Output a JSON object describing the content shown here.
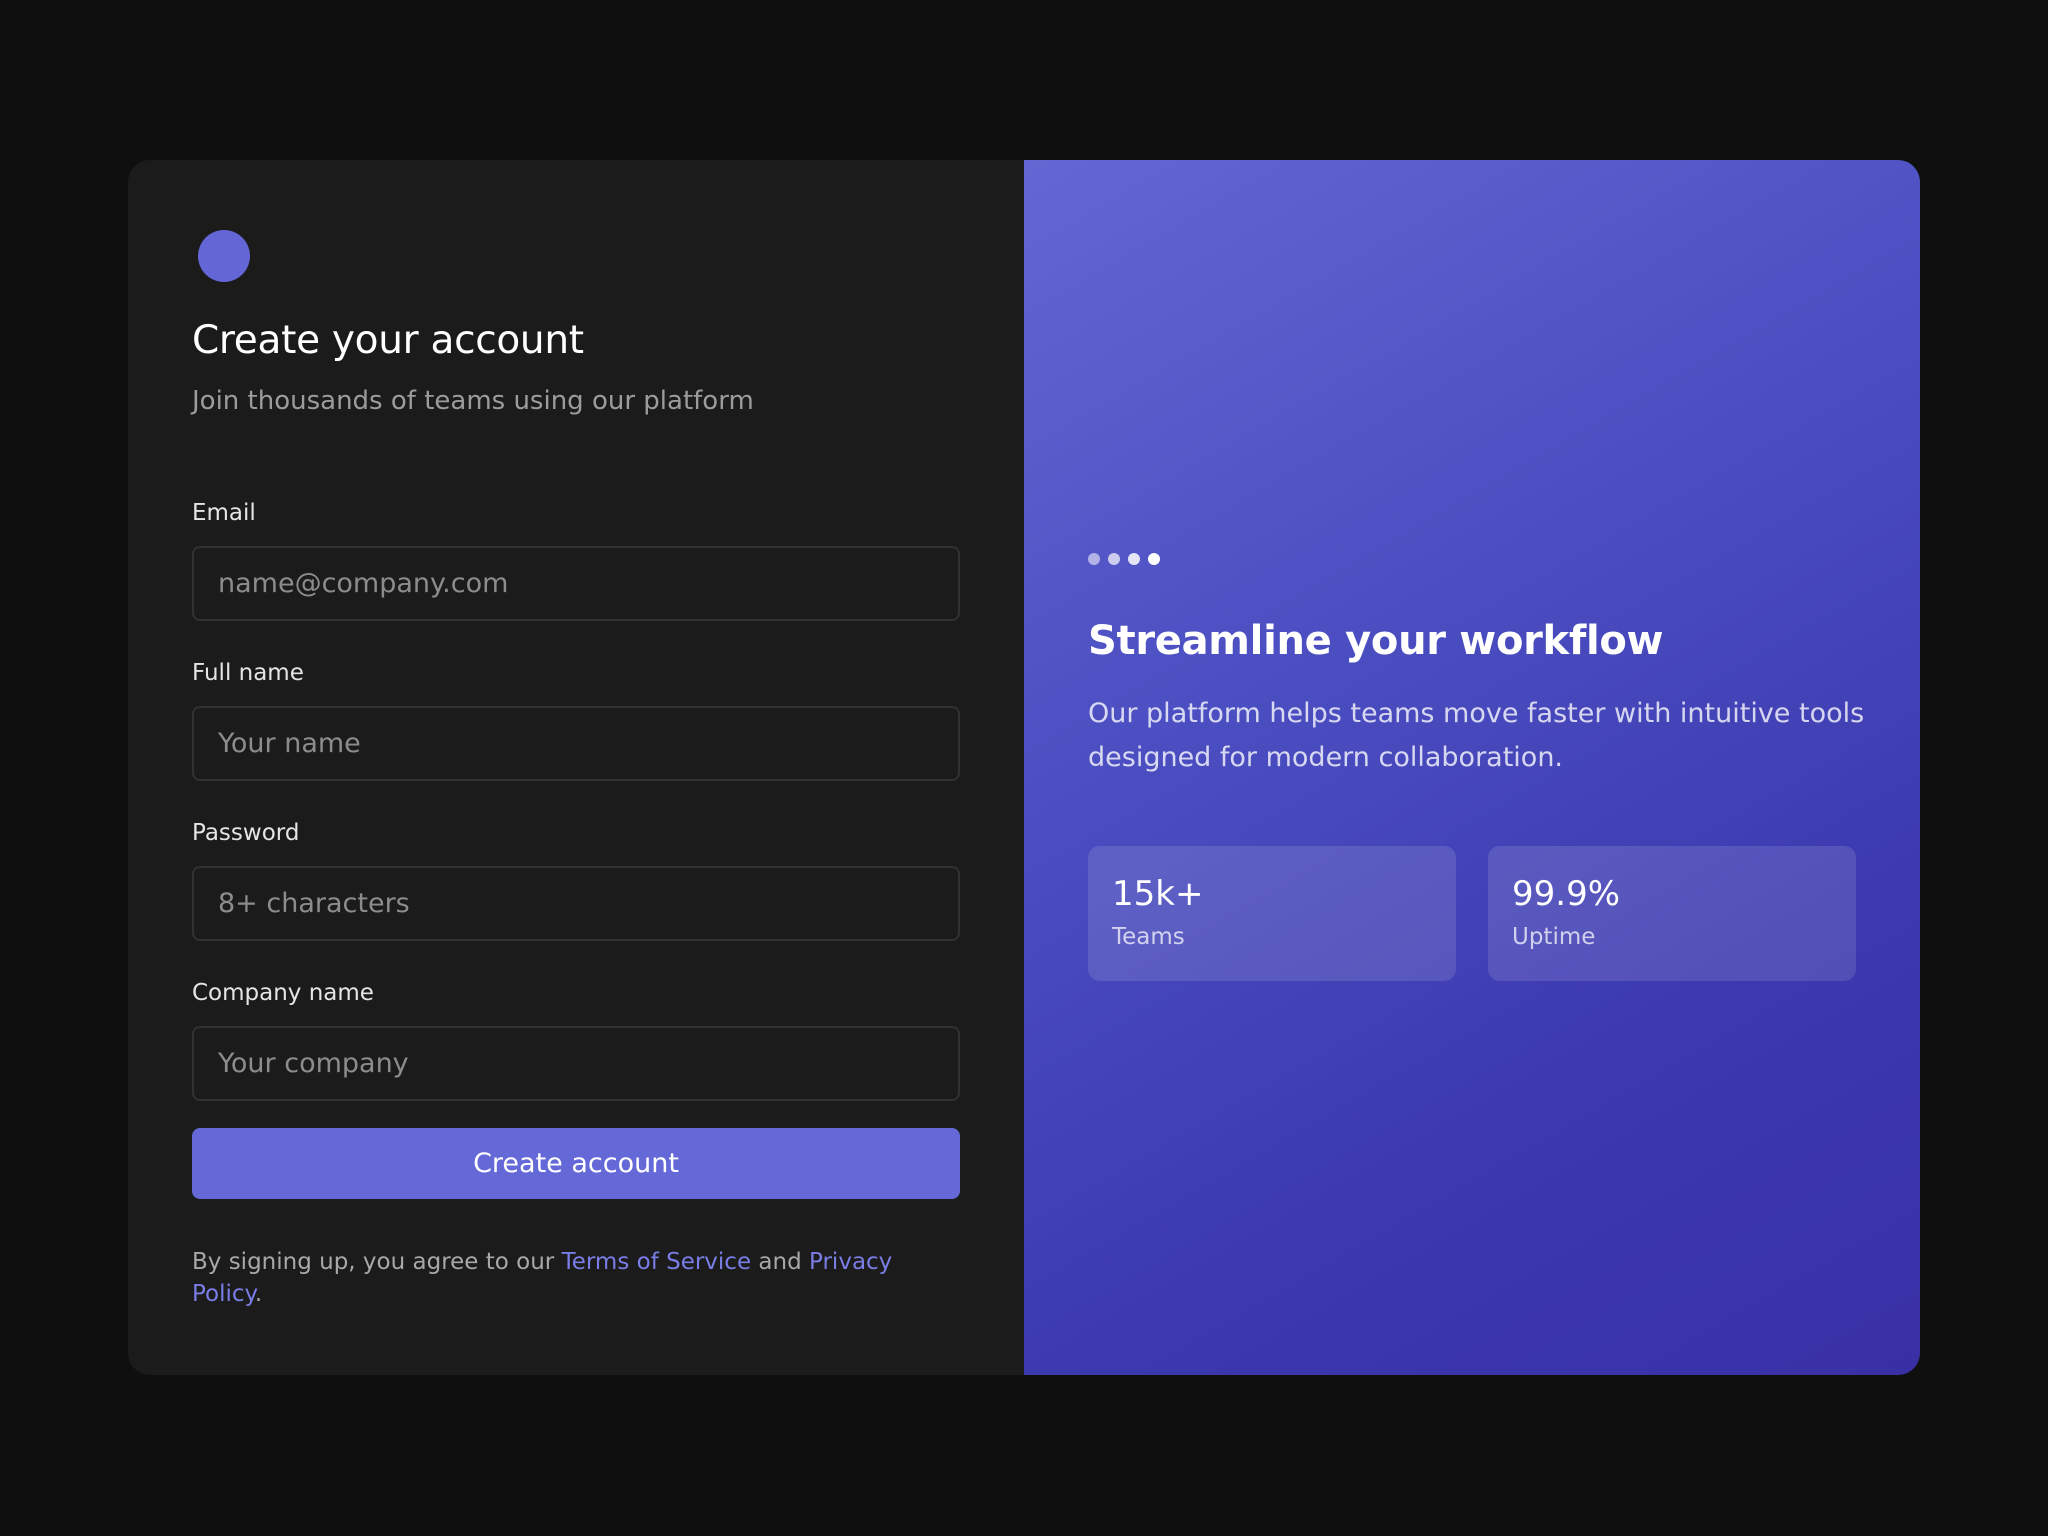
{
  "form": {
    "title": "Create your account",
    "subtitle": "Join thousands of teams using our platform",
    "fields": [
      {
        "label": "Email",
        "placeholder": "name@company.com"
      },
      {
        "label": "Full name",
        "placeholder": "Your name"
      },
      {
        "label": "Password",
        "placeholder": "8+ characters"
      },
      {
        "label": "Company name",
        "placeholder": "Your company"
      }
    ],
    "submit_label": "Create account",
    "terms": {
      "prefix": "By signing up, you agree to our ",
      "tos_link": "Terms of Service",
      "middle": " and ",
      "privacy_link": "Privacy Policy",
      "suffix": "."
    }
  },
  "promo": {
    "title": "Streamline your workflow",
    "description": "Our platform helps teams move faster with intuitive tools designed for modern collaboration.",
    "stats": [
      {
        "value": "15k+",
        "label": "Teams"
      },
      {
        "value": "99.9%",
        "label": "Uptime"
      }
    ],
    "carousel_total": 4,
    "carousel_active": 4
  },
  "colors": {
    "accent": "#6469d7",
    "link": "#7a7de6",
    "panel_dark": "#1b1b1b",
    "background": "#0f0f0f"
  },
  "icons": {
    "logo": "logo-circle-icon"
  }
}
